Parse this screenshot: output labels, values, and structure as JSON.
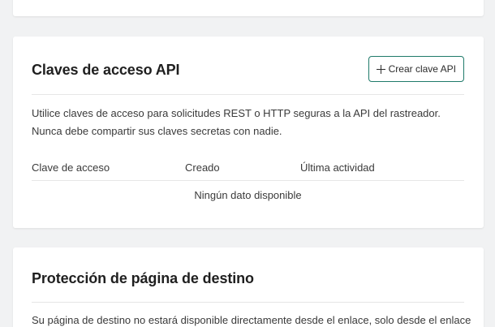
{
  "api_keys": {
    "title": "Claves de acceso API",
    "create_button_label": "Crear clave API",
    "description_line1": "Utilice claves de acceso para solicitudes REST o HTTP seguras a la API del rastreador.",
    "description_line2": "Nunca debe compartir sus claves secretas con nadie.",
    "table": {
      "columns": [
        "Clave de acceso",
        "Creado",
        "Última actividad"
      ],
      "empty_message": "Ningún dato disponible"
    }
  },
  "landing_protection": {
    "title": "Protección de página de destino",
    "description": "Su página de destino no estará disponible directamente desde el enlace, solo desde el enlace"
  },
  "icons": {
    "create_button_icon": "plus-icon"
  },
  "colors": {
    "accent_border": "#1f7a6a",
    "background": "#f1f2f3",
    "card": "#ffffff"
  }
}
